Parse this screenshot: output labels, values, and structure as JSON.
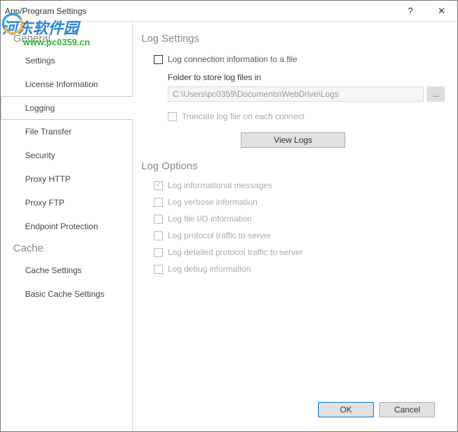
{
  "window": {
    "title": "App/Program Settings",
    "help_glyph": "?",
    "close_glyph": "✕"
  },
  "watermark": {
    "text_cn": "河东软件园",
    "url": "www.pc0359.cn"
  },
  "sidebar": {
    "groups": [
      {
        "label": "General",
        "items": [
          {
            "label": "Settings",
            "selected": false
          },
          {
            "label": "License Information",
            "selected": false
          },
          {
            "label": "Logging",
            "selected": true
          },
          {
            "label": "File Transfer",
            "selected": false
          },
          {
            "label": "Security",
            "selected": false
          },
          {
            "label": "Proxy HTTP",
            "selected": false
          },
          {
            "label": "Proxy FTP",
            "selected": false
          },
          {
            "label": "Endpoint Protection",
            "selected": false
          }
        ]
      },
      {
        "label": "Cache",
        "items": [
          {
            "label": "Cache Settings",
            "selected": false
          },
          {
            "label": "Basic Cache Settings",
            "selected": false
          }
        ]
      }
    ]
  },
  "main": {
    "log_settings": {
      "heading": "Log Settings",
      "log_to_file": {
        "label": "Log connection information to a file",
        "checked": false,
        "enabled": true
      },
      "folder_label": "Folder to store log files in",
      "folder_path": "C:\\Users\\pc0359\\Documents\\WebDrive\\Logs",
      "browse_glyph": "...",
      "truncate": {
        "label": "Truncate log file on each connect",
        "checked": false,
        "enabled": false
      },
      "view_logs_label": "View Logs"
    },
    "log_options": {
      "heading": "Log Options",
      "items": [
        {
          "label": "Log informational messages",
          "checked": true,
          "enabled": false
        },
        {
          "label": "Log verbose information",
          "checked": false,
          "enabled": false
        },
        {
          "label": "Log file I/O information",
          "checked": false,
          "enabled": false
        },
        {
          "label": "Log protocol traffic to server",
          "checked": false,
          "enabled": false
        },
        {
          "label": "Log detailed protocol traffic to server",
          "checked": false,
          "enabled": false
        },
        {
          "label": "Log debug information",
          "checked": false,
          "enabled": false
        }
      ]
    }
  },
  "footer": {
    "ok": "OK",
    "cancel": "Cancel"
  }
}
